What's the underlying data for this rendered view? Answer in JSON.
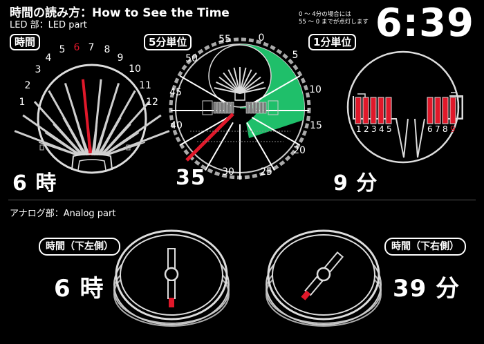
{
  "header": {
    "title": "時間の読み方：How to See the Time",
    "subtitle": "LED 部：LED part",
    "big_time": "6:39",
    "note_line1": "0 ～ 4分の場合には",
    "note_line2": "55 ～ 0 までが点灯します"
  },
  "led": {
    "hour": {
      "badge": "時間",
      "reading": "6 時",
      "dial_numbers": [
        "1",
        "2",
        "3",
        "4",
        "5",
        "6",
        "7",
        "8",
        "9",
        "10",
        "11",
        "12"
      ],
      "active_number": "6"
    },
    "five_min": {
      "badge": "5分単位",
      "reading": "35",
      "dial_numbers": [
        "55",
        "0",
        "5",
        "10",
        "15",
        "20",
        "25",
        "30",
        "35",
        "40",
        "45",
        "50"
      ]
    },
    "one_min": {
      "badge": "1分単位",
      "reading": "9 分",
      "left_digits": [
        "1",
        "2",
        "3",
        "4",
        "5"
      ],
      "right_digits": [
        "6",
        "7",
        "8"
      ],
      "active_digit": "9"
    }
  },
  "analog": {
    "section_label": "アナログ部：Analog part",
    "left": {
      "badge": "時間（下左側）",
      "reading": "6 時"
    },
    "right": {
      "badge": "時間（下右側）",
      "reading": "39 分"
    }
  },
  "colors": {
    "accent_red": "#e0182a",
    "lit_green": "#1fbf6a",
    "dial_grey": "#bbbbbb"
  }
}
